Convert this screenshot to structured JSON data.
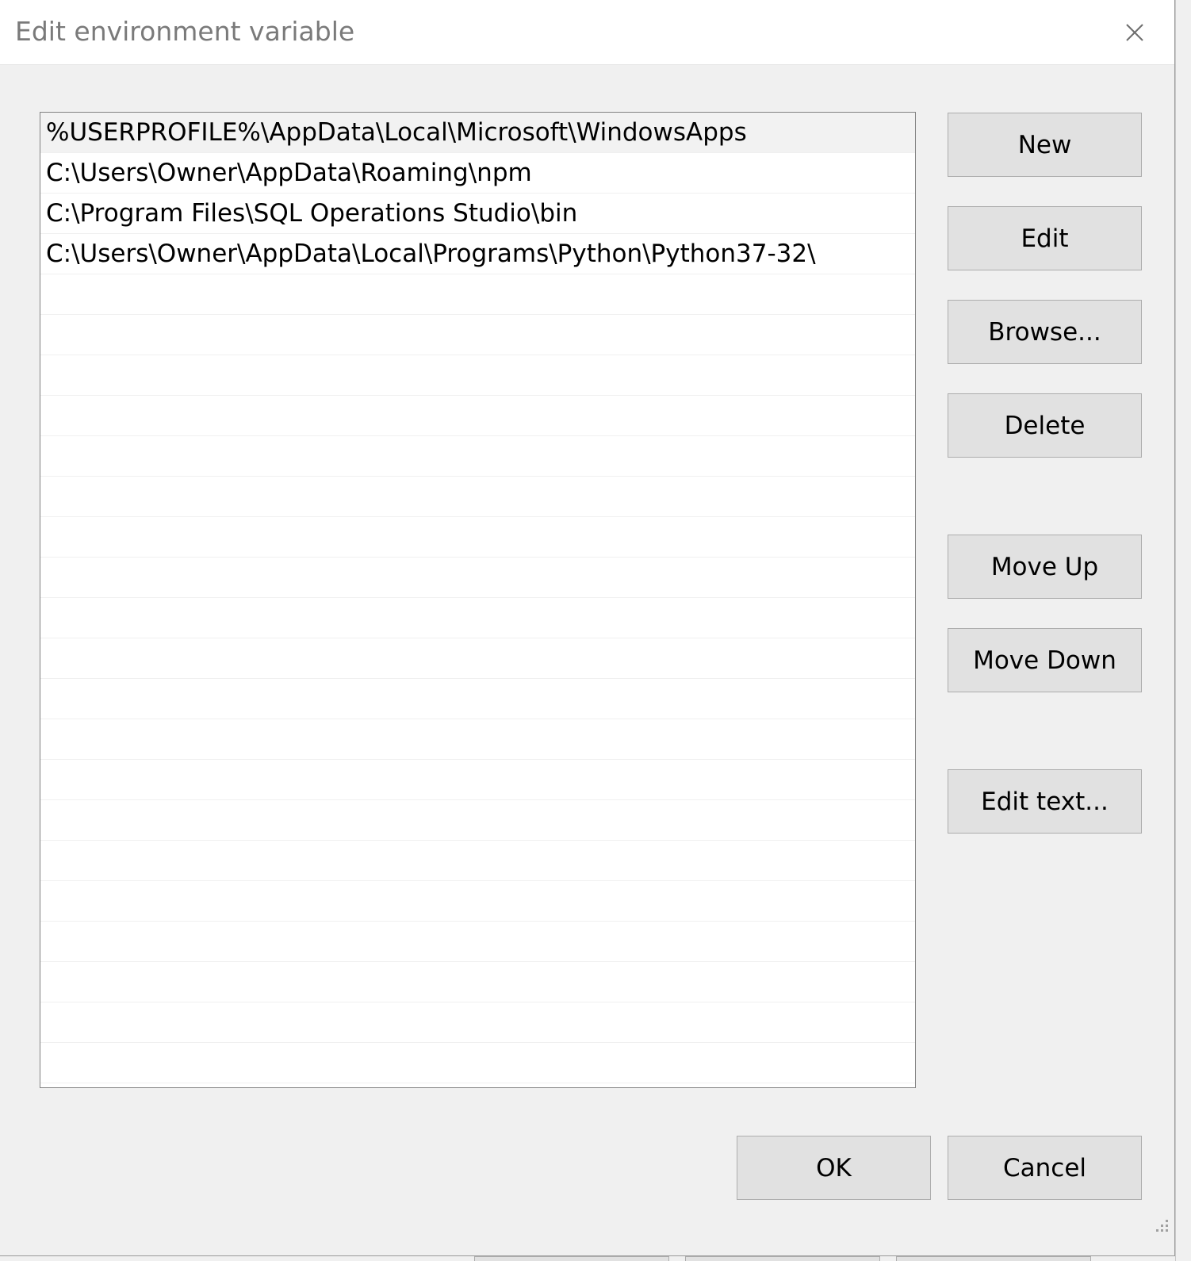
{
  "window": {
    "title": "Edit environment variable",
    "close_icon": "close-icon"
  },
  "list": {
    "items": [
      "%USERPROFILE%\\AppData\\Local\\Microsoft\\WindowsApps",
      "C:\\Users\\Owner\\AppData\\Roaming\\npm",
      "C:\\Program Files\\SQL Operations Studio\\bin",
      "C:\\Users\\Owner\\AppData\\Local\\Programs\\Python\\Python37-32\\"
    ],
    "selected_index": 0
  },
  "buttons": {
    "new": "New",
    "edit": "Edit",
    "browse": "Browse...",
    "delete": "Delete",
    "move_up": "Move Up",
    "move_down": "Move Down",
    "edit_text": "Edit text...",
    "ok": "OK",
    "cancel": "Cancel"
  },
  "colors": {
    "dialog_bg": "#f0f0f0",
    "button_bg": "#e1e1e1",
    "button_border": "#adadad",
    "selected_row": "#f2f2f2",
    "title_text": "#7a7a7a"
  }
}
